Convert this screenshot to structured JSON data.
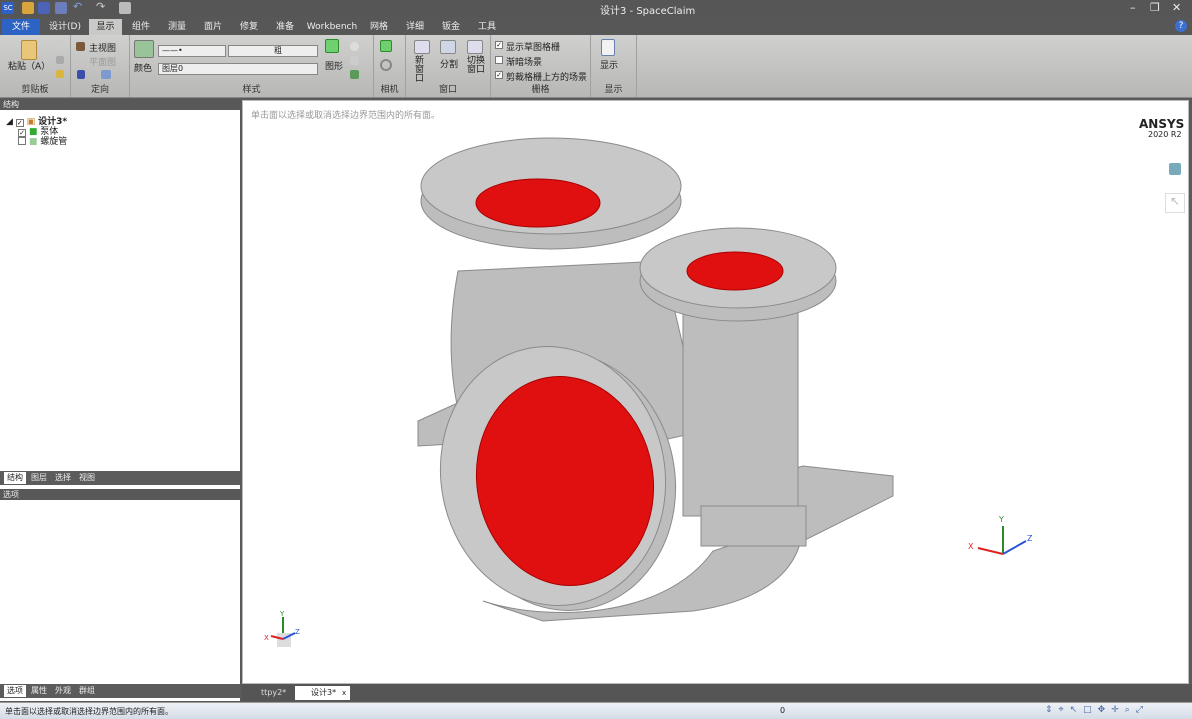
{
  "window": {
    "title": "设计3 - SpaceClaim",
    "app_icon": "SC",
    "minimize": "–",
    "restore": "❐",
    "close": "✕"
  },
  "ribbon_tabs": [
    "文件",
    "设计(D)",
    "显示",
    "组件",
    "测量",
    "面片",
    "修复",
    "准备",
    "Workbench",
    "网格",
    "详细",
    "钣金",
    "工具"
  ],
  "active_tab": "显示",
  "ribbon": {
    "clipboard": {
      "paste": "粘贴（A）",
      "label": "剪贴板"
    },
    "orient": {
      "home": "主视图",
      "plan": "平面图",
      "label": "定向"
    },
    "style": {
      "color": "颜色",
      "line_weight": "粗",
      "layer": "图层0",
      "graphics": "图形",
      "label": "样式"
    },
    "camera": {
      "label": "相机"
    },
    "window": {
      "new": "新窗口",
      "split": "分割",
      "switch": "切换窗口",
      "label": "窗口"
    },
    "grid": {
      "items": [
        {
          "label": "显示草图格栅",
          "checked": true
        },
        {
          "label": "渐暗场景",
          "checked": false
        },
        {
          "label": "剪裁格栅上方的场景",
          "checked": true
        }
      ],
      "label": "栅格"
    },
    "show": {
      "button": "显示",
      "label": "显示"
    }
  },
  "structure": {
    "header": "结构",
    "pin": "ᵖ",
    "tree": [
      {
        "label": "设计3*",
        "checked": true
      },
      {
        "label": "泵体",
        "checked": true
      },
      {
        "label": "螺旋管",
        "checked": false
      }
    ],
    "tabs": [
      "结构",
      "图层",
      "选择",
      "视图"
    ],
    "active": "结构"
  },
  "options": {
    "header": "选项",
    "tabs": [
      "选项",
      "属性",
      "外观",
      "群组"
    ],
    "active": "选项"
  },
  "viewport": {
    "hint": "单击面以选择或取消选择边界范围内的所有面。",
    "brand": "ANSYS",
    "version": "2020 R2",
    "axes": {
      "x": "X",
      "y": "Y",
      "z": "Z"
    },
    "colors": {
      "body": "#b9b9b9",
      "interior": "#e01010"
    }
  },
  "doc_tabs": [
    {
      "label": "ttpy2*",
      "active": false
    },
    {
      "label": "设计3*",
      "active": true
    }
  ],
  "status": {
    "message": "单击面以选择或取消选择边界范围内的所有面。",
    "count": "0"
  }
}
